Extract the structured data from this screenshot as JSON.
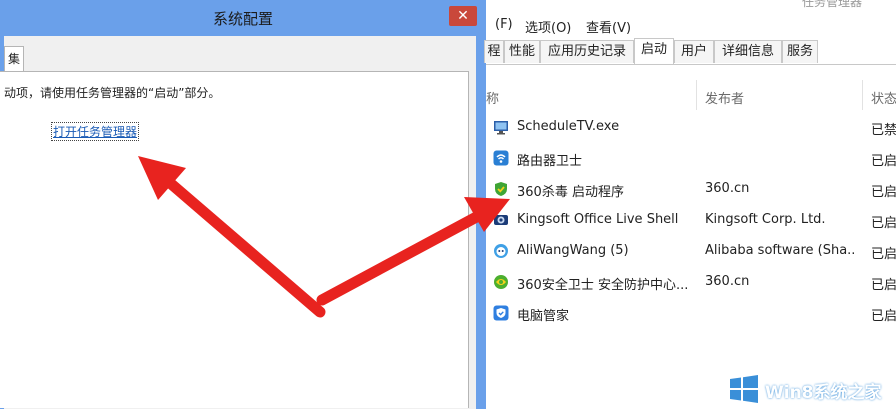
{
  "msconfig": {
    "title": "系统配置",
    "close_glyph": "✕",
    "partial_tab_label": "集",
    "info_text": "动项，请使用任务管理器的“启动”部分。",
    "open_task_manager_link": "打开任务管理器"
  },
  "taskmgr": {
    "title_partial": "任务管理器",
    "menu": [
      "(F)",
      "选项(O)",
      "查看(V)"
    ],
    "tabs": [
      "程",
      "性能",
      "应用历史记录",
      "启动",
      "用户",
      "详细信息",
      "服务"
    ],
    "active_tab": "启动",
    "columns": {
      "name": "称",
      "publisher": "发布者",
      "status": "状态"
    },
    "rows": [
      {
        "name": "ScheduleTV.exe",
        "publisher": "",
        "status": "已禁",
        "icon": "monitor-icon"
      },
      {
        "name": "路由器卫士",
        "publisher": "",
        "status": "已启",
        "icon": "router-wifi-icon"
      },
      {
        "name": "360杀毒 启动程序",
        "publisher": "360.cn",
        "status": "已启",
        "icon": "shield-green-icon"
      },
      {
        "name": "Kingsoft Office Live Shell",
        "publisher": "Kingsoft Corp. Ltd.",
        "status": "已启",
        "icon": "kingsoft-icon"
      },
      {
        "name": "AliWangWang (5)",
        "publisher": "Alibaba software (Sha...",
        "status": "已启",
        "icon": "aliwangwang-icon"
      },
      {
        "name": "360安全卫士 安全防护中心...",
        "publisher": "360.cn",
        "status": "已启",
        "icon": "360-safe-icon"
      },
      {
        "name": "电脑管家",
        "publisher": "",
        "status": "已启",
        "icon": "pc-manager-icon"
      }
    ]
  },
  "watermark": {
    "text": "Win8系统之家"
  },
  "colors": {
    "title_bar": "#6aa0ea",
    "close_button": "#c9483b",
    "arrow": "#e8231f",
    "link": "#1a5bb5"
  }
}
